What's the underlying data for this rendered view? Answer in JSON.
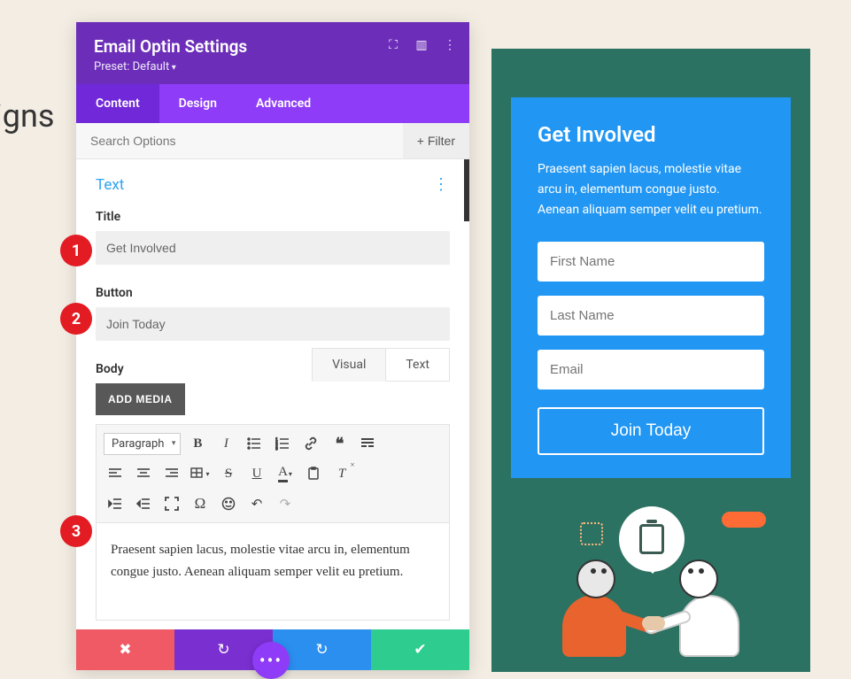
{
  "bg_text": "igns",
  "panel": {
    "title": "Email Optin Settings",
    "preset": "Preset: Default",
    "tabs": {
      "content": "Content",
      "design": "Design",
      "advanced": "Advanced"
    },
    "search_placeholder": "Search Options",
    "filter": "Filter"
  },
  "text_section": {
    "header": "Text",
    "title_label": "Title",
    "title_value": "Get Involved",
    "button_label": "Button",
    "button_value": "Join Today",
    "body_label": "Body",
    "add_media": "ADD MEDIA",
    "editor_tabs": {
      "visual": "Visual",
      "text": "Text"
    },
    "paragraph_select": "Paragraph",
    "body_content": "Praesent sapien lacus, molestie vitae arcu in, elementum congue justo. Aenean aliquam semper velit eu pretium."
  },
  "markers": {
    "one": "1",
    "two": "2",
    "three": "3"
  },
  "preview": {
    "title": "Get Involved",
    "desc": "Praesent sapien lacus, molestie vitae arcu in, elementum congue justo. Aenean aliquam semper velit eu pretium.",
    "first_name": "First Name",
    "last_name": "Last Name",
    "email": "Email",
    "button": "Join Today"
  }
}
